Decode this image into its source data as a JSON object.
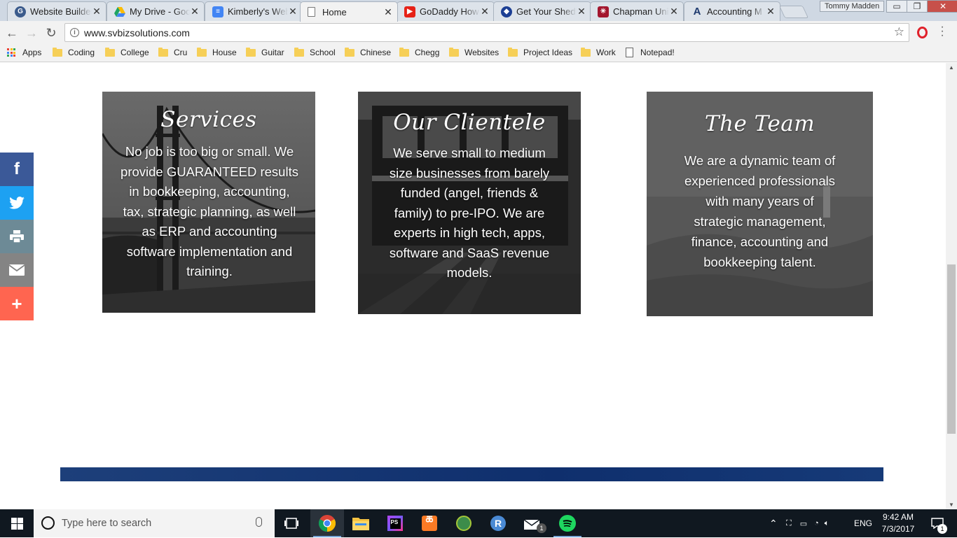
{
  "browser": {
    "tabs": [
      {
        "title": "Website Builder",
        "favicon_color": "#3b5b8c"
      },
      {
        "title": "My Drive - Google Drive",
        "favicon_color": "#1fa463"
      },
      {
        "title": "Kimberly's Website",
        "favicon_color": "#4285f4"
      },
      {
        "title": "Home",
        "favicon_color": "#ffffff"
      },
      {
        "title": "GoDaddy How to",
        "favicon_color": "#e62117"
      },
      {
        "title": "Get Your Shed",
        "favicon_color": "#1c3f94"
      },
      {
        "title": "Chapman University",
        "favicon_color": "#a3162e"
      },
      {
        "title": "Accounting M",
        "favicon_color": "#1e3a6e"
      }
    ],
    "active_tab_index": 3,
    "profile_name": "Tommy Madden",
    "url": "www.svbizsolutions.com"
  },
  "bookmarks": [
    {
      "label": "Apps",
      "icon": "apps-grid-icon"
    },
    {
      "label": "Coding",
      "icon": "folder-icon"
    },
    {
      "label": "College",
      "icon": "folder-icon"
    },
    {
      "label": "Cru",
      "icon": "folder-icon"
    },
    {
      "label": "House",
      "icon": "folder-icon"
    },
    {
      "label": "Guitar",
      "icon": "folder-icon"
    },
    {
      "label": "School",
      "icon": "folder-icon"
    },
    {
      "label": "Chinese",
      "icon": "folder-icon"
    },
    {
      "label": "Chegg",
      "icon": "folder-icon"
    },
    {
      "label": "Websites",
      "icon": "folder-icon"
    },
    {
      "label": "Project Ideas",
      "icon": "folder-icon"
    },
    {
      "label": "Work",
      "icon": "folder-icon"
    },
    {
      "label": "Notepad!",
      "icon": "page-icon"
    }
  ],
  "page": {
    "cards": [
      {
        "title": "Services",
        "text": "No job is too big or small. We provide GUARANTEED results in bookkeeping, accounting, tax, strategic planning, as well as ERP and accounting software implementation and training."
      },
      {
        "title": "Our Clientele",
        "text": "We serve small to medium size businesses from barely funded (angel, friends & family) to pre-IPO. We are experts in high tech, apps, software and SaaS revenue models."
      },
      {
        "title": "The Team",
        "text": "We are a dynamic team of experienced professionals with many years of strategic management, finance, accounting and bookkeeping talent."
      }
    ],
    "share_buttons": [
      {
        "name": "facebook",
        "color": "#3b5998"
      },
      {
        "name": "twitter",
        "color": "#1da1f2"
      },
      {
        "name": "print",
        "color": "#6d8a96"
      },
      {
        "name": "email",
        "color": "#848484"
      },
      {
        "name": "more",
        "color": "#ff6550"
      }
    ],
    "footer_color": "#163a78"
  },
  "taskbar": {
    "search_placeholder": "Type here to search",
    "apps": [
      {
        "name": "task-view"
      },
      {
        "name": "chrome",
        "running": true
      },
      {
        "name": "file-explorer"
      },
      {
        "name": "phpstorm",
        "label": "PS"
      },
      {
        "name": "xampp"
      },
      {
        "name": "android-studio"
      },
      {
        "name": "r-studio",
        "label": "R"
      },
      {
        "name": "mail",
        "badge": "1"
      },
      {
        "name": "spotify"
      }
    ],
    "language": "ENG",
    "time": "9:42 AM",
    "date": "7/3/2017",
    "notification_count": "1"
  }
}
